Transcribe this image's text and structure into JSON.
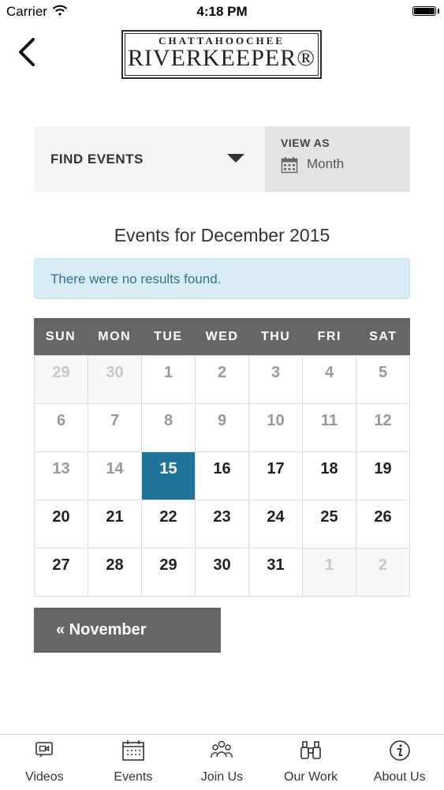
{
  "status_bar": {
    "carrier": "Carrier",
    "time": "4:18 PM"
  },
  "header": {
    "logo_top": "CHATTAHOOCHEE",
    "logo_main": "RIVERKEEPER®"
  },
  "filter_bar": {
    "find_events": "FIND EVENTS",
    "view_as_label": "VIEW AS",
    "view_as_value": "Month"
  },
  "heading": "Events for December 2015",
  "notice": "There were no results found.",
  "calendar": {
    "weekdays": [
      "SUN",
      "MON",
      "TUE",
      "WED",
      "THU",
      "FRI",
      "SAT"
    ],
    "weeks": [
      [
        {
          "d": "29",
          "s": "other"
        },
        {
          "d": "30",
          "s": "other"
        },
        {
          "d": "1",
          "s": "past"
        },
        {
          "d": "2",
          "s": "past"
        },
        {
          "d": "3",
          "s": "past"
        },
        {
          "d": "4",
          "s": "past"
        },
        {
          "d": "5",
          "s": "past"
        }
      ],
      [
        {
          "d": "6",
          "s": "past"
        },
        {
          "d": "7",
          "s": "past"
        },
        {
          "d": "8",
          "s": "past"
        },
        {
          "d": "9",
          "s": "past"
        },
        {
          "d": "10",
          "s": "past"
        },
        {
          "d": "11",
          "s": "past"
        },
        {
          "d": "12",
          "s": "past"
        }
      ],
      [
        {
          "d": "13",
          "s": "past"
        },
        {
          "d": "14",
          "s": "past"
        },
        {
          "d": "15",
          "s": "today"
        },
        {
          "d": "16",
          "s": "future"
        },
        {
          "d": "17",
          "s": "future"
        },
        {
          "d": "18",
          "s": "future"
        },
        {
          "d": "19",
          "s": "future"
        }
      ],
      [
        {
          "d": "20",
          "s": "future"
        },
        {
          "d": "21",
          "s": "future"
        },
        {
          "d": "22",
          "s": "future"
        },
        {
          "d": "23",
          "s": "future"
        },
        {
          "d": "24",
          "s": "future"
        },
        {
          "d": "25",
          "s": "future"
        },
        {
          "d": "26",
          "s": "future"
        }
      ],
      [
        {
          "d": "27",
          "s": "future"
        },
        {
          "d": "28",
          "s": "future"
        },
        {
          "d": "29",
          "s": "future"
        },
        {
          "d": "30",
          "s": "future"
        },
        {
          "d": "31",
          "s": "future"
        },
        {
          "d": "1",
          "s": "other"
        },
        {
          "d": "2",
          "s": "other"
        }
      ]
    ]
  },
  "prev_month": "« November",
  "tabs": [
    {
      "label": "Videos",
      "icon": "video-icon"
    },
    {
      "label": "Events",
      "icon": "calendar-icon"
    },
    {
      "label": "Join Us",
      "icon": "people-icon"
    },
    {
      "label": "Our Work",
      "icon": "binoculars-icon"
    },
    {
      "label": "About Us",
      "icon": "info-icon"
    }
  ],
  "colors": {
    "accent": "#21759b",
    "dark_gray": "#666666",
    "notice_bg": "#d9edf7"
  }
}
